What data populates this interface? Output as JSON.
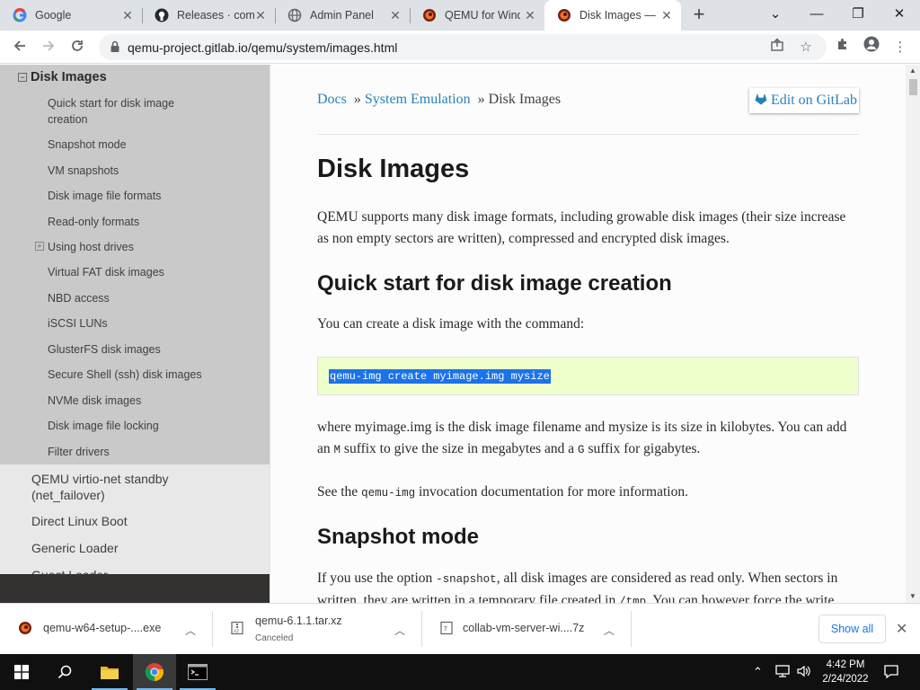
{
  "browser": {
    "tabs": [
      {
        "title": "Google",
        "icon": "google-icon",
        "active": false
      },
      {
        "title": "Releases · comp",
        "icon": "github-icon",
        "active": false
      },
      {
        "title": "Admin Panel",
        "icon": "globe-icon",
        "active": false
      },
      {
        "title": "QEMU for Wind",
        "icon": "qemu-icon",
        "active": false
      },
      {
        "title": "Disk Images —",
        "icon": "qemu-icon",
        "active": true
      }
    ],
    "url": "qemu-project.gitlab.io/qemu/system/images.html"
  },
  "sidebar": {
    "section_title": "Disk Images",
    "items": [
      "Quick start for disk image creation",
      "Snapshot mode",
      "VM snapshots",
      "Disk image file formats",
      "Read-only formats",
      "Using host drives",
      "Virtual FAT disk images",
      "NBD access",
      "iSCSI LUNs",
      "GlusterFS disk images",
      "Secure Shell (ssh) disk images",
      "NVMe disk images",
      "Disk image file locking",
      "Filter drivers"
    ],
    "top_items": [
      "QEMU virtio-net standby (net_failover)",
      "Direct Linux Boot",
      "Generic Loader",
      "Guest Loader"
    ]
  },
  "content": {
    "breadcrumb": {
      "docs": "Docs",
      "sep1": "»",
      "system": "System Emulation",
      "sep2": "»",
      "current": "Disk Images"
    },
    "edit_label": "Edit on GitLab",
    "title": "Disk Images",
    "intro": "QEMU supports many disk image formats, including growable disk images (their size increase as non empty sectors are written), compressed and encrypted disk images.",
    "h_quick": "Quick start for disk image creation",
    "p_command": "You can create a disk image with the command:",
    "code": "qemu-img create myimage.img mysize",
    "p_where_1": "where myimage.img is the disk image filename and mysize is its size in kilobytes. You can add an ",
    "code_m": "M",
    "p_where_2": " suffix to give the size in megabytes and a ",
    "code_g": "G",
    "p_where_3": " suffix for gigabytes.",
    "p_see_1": "See the ",
    "code_qemuimg": "qemu-img",
    "p_see_2": " invocation documentation for more information.",
    "h_snapshot": "Snapshot mode",
    "p_snap_1": "If you use the option ",
    "code_snapshot": "-snapshot",
    "p_snap_2": ", all disk images are considered as read only. When sectors in written, they are written in a temporary file created in ",
    "code_tmp": "/tmp",
    "p_snap_3": ". You can however force the write"
  },
  "downloads": {
    "items": [
      {
        "name": "qemu-w64-setup-....exe",
        "status": ""
      },
      {
        "name": "qemu-6.1.1.tar.xz",
        "status": "Canceled"
      },
      {
        "name": "collab-vm-server-wi....7z",
        "status": ""
      }
    ],
    "show_all": "Show all"
  },
  "taskbar": {
    "time": "4:42 PM",
    "date": "2/24/2022"
  },
  "colors": {
    "link": "#2980b9",
    "sidebar_sub": "#c9c9c9",
    "sidebar": "#e8e8e8",
    "code_bg": "#eeffcc",
    "selection": "#1a73e8"
  }
}
